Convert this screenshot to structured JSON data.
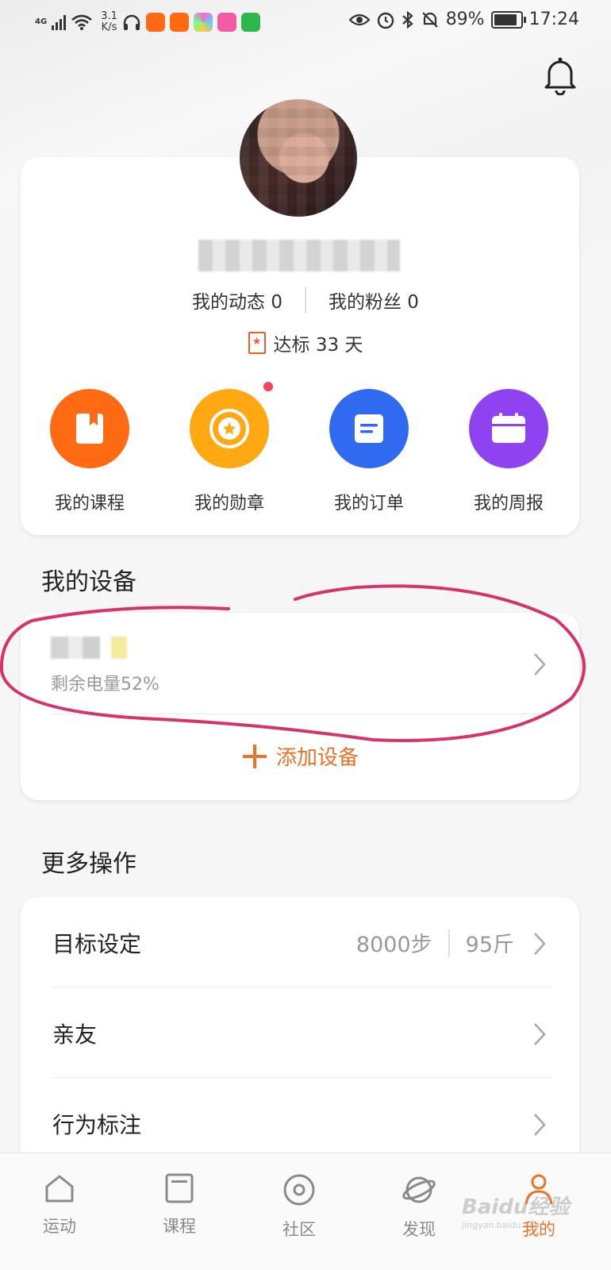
{
  "status_bar": {
    "network": "4G",
    "speed_value": "3.1",
    "speed_unit": "K/s",
    "battery_percent": "89%",
    "battery_level": 0.89,
    "time": "17:24"
  },
  "profile": {
    "dynamics_label": "我的动态 0",
    "fans_label": "我的粉丝 0",
    "streak_label": "达标 33 天"
  },
  "quick_actions": [
    {
      "label": "我的课程",
      "color": "#ff6a13"
    },
    {
      "label": "我的勋章",
      "color": "#ffa812"
    },
    {
      "label": "我的订单",
      "color": "#2f6af0"
    },
    {
      "label": "我的周报",
      "color": "#8f42f0"
    }
  ],
  "devices_section": {
    "title": "我的设备",
    "battery_text": "剩余电量52%",
    "add_label": "添加设备"
  },
  "more_section": {
    "title": "更多操作",
    "rows": [
      {
        "label": "目标设定",
        "steps": "8000步",
        "weight": "95斤"
      },
      {
        "label": "亲友"
      },
      {
        "label": "行为标注"
      }
    ]
  },
  "tabs": [
    {
      "label": "运动"
    },
    {
      "label": "课程"
    },
    {
      "label": "社区"
    },
    {
      "label": "发现"
    },
    {
      "label": "我的"
    }
  ],
  "watermark": {
    "brand": "Baidu经验",
    "url": "jingyan.baidu.com"
  },
  "colors": {
    "accent": "#e8742a",
    "annotation": "#d6336c"
  }
}
